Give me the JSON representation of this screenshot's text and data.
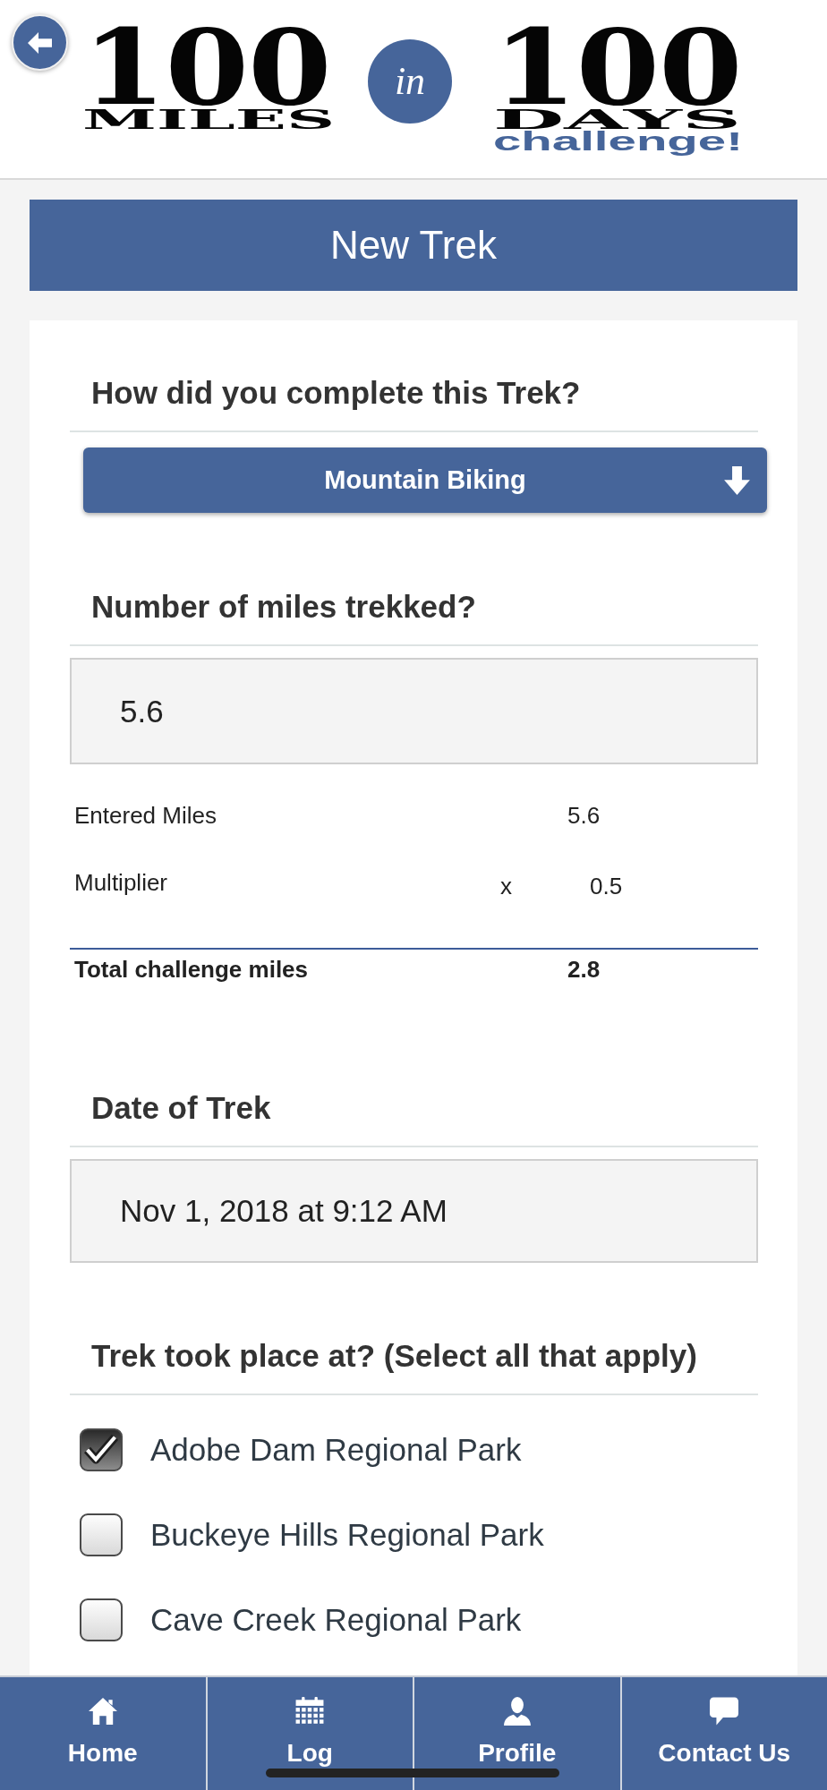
{
  "logo": {
    "left_number": "100",
    "left_word": "MILES",
    "connector": "in",
    "right_number": "100",
    "right_word": "DAYS",
    "tagline": "challenge!"
  },
  "title_bar": {
    "title": "New Trek"
  },
  "form": {
    "activity": {
      "heading": "How did you complete this Trek?",
      "value": "Mountain Biking"
    },
    "miles": {
      "heading": "Number of miles trekked?",
      "value": "5.6"
    },
    "calculation": [
      {
        "kind": "value",
        "label": "Entered Miles",
        "value": "5.6"
      },
      {
        "kind": "factor",
        "label": "Multiplier",
        "operator": "x",
        "value": "0.5"
      },
      {
        "kind": "total",
        "label": "Total challenge miles",
        "value": "2.8"
      }
    ],
    "date": {
      "heading": "Date of Trek",
      "value": "Nov 1, 2018 at 9:12 AM"
    },
    "locations": {
      "heading": "Trek took place at? (Select all that apply)",
      "options": [
        {
          "label": "Adobe Dam Regional Park",
          "checked": true
        },
        {
          "label": "Buckeye Hills Regional Park",
          "checked": false
        },
        {
          "label": "Cave Creek Regional Park",
          "checked": false
        }
      ]
    }
  },
  "bottom_nav": [
    {
      "kind": "home",
      "label": "Home",
      "selected": false
    },
    {
      "kind": "calendar",
      "label": "Log",
      "selected": false
    },
    {
      "kind": "person",
      "label": "Profile",
      "selected": false
    },
    {
      "kind": "chat",
      "label": "Contact Us",
      "selected": false
    }
  ]
}
